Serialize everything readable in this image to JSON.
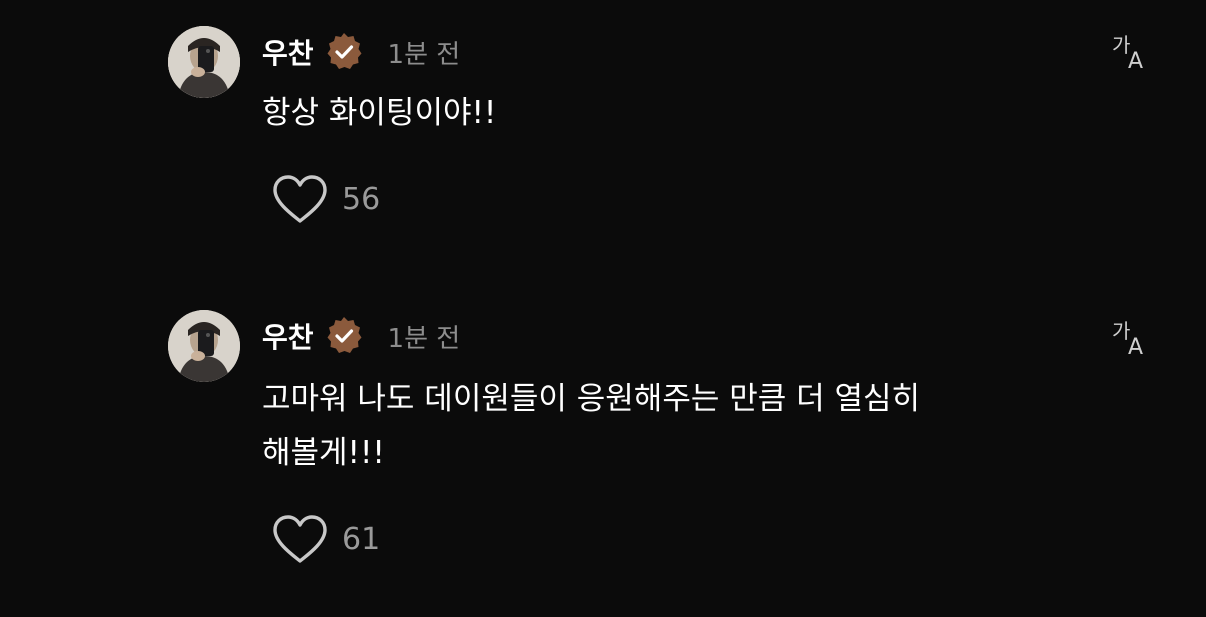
{
  "comments": [
    {
      "username": "우찬",
      "verified_icon": "verified-badge-icon",
      "time": "1분 전",
      "message_lines": [
        "항상 화이팅이야!!"
      ],
      "likes": "56",
      "translate_icon": "translate-icon"
    },
    {
      "username": "우찬",
      "verified_icon": "verified-badge-icon",
      "time": "1분 전",
      "message_lines": [
        "고마워 나도 데이원들이 응원해주는 만큼 더 열심히",
        "해볼게!!!"
      ],
      "likes": "61",
      "translate_icon": "translate-icon"
    }
  ],
  "colors": {
    "background": "#0b0b0b",
    "text": "#ffffff",
    "muted": "#8d8d8d",
    "badge": "#8b5a3c"
  }
}
